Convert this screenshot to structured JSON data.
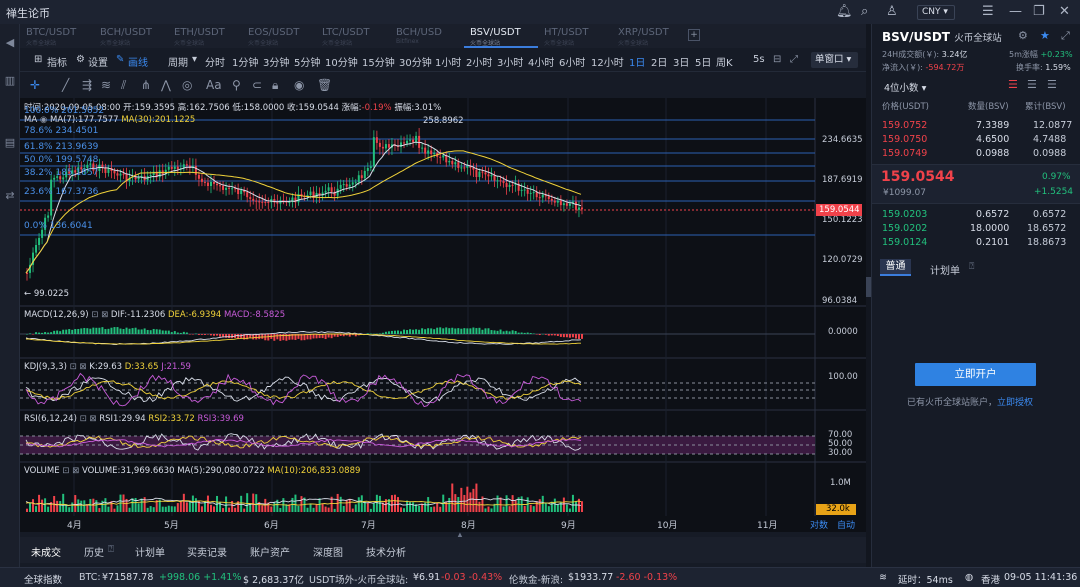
{
  "app": {
    "title": "禅生论币",
    "currency": "CNY"
  },
  "tabs": [
    {
      "name": "BTC/USDT",
      "sub": "火币全球站"
    },
    {
      "name": "BCH/USDT",
      "sub": "火币全球站"
    },
    {
      "name": "ETH/USDT",
      "sub": "火币全球站"
    },
    {
      "name": "EOS/USDT",
      "sub": "火币全球站"
    },
    {
      "name": "LTC/USDT",
      "sub": "火币全球站"
    },
    {
      "name": "BCH/USD",
      "sub": "Bitfinex"
    },
    {
      "name": "BSV/USDT",
      "sub": "火币全球站"
    },
    {
      "name": "HT/USDT",
      "sub": "火币全球站"
    },
    {
      "name": "XRP/USDT",
      "sub": "火币全球站"
    }
  ],
  "toolbar": {
    "indicator": "指标",
    "settings": "设置",
    "draw": "画线",
    "period": "周期",
    "intervals": [
      "分时",
      "1分钟",
      "3分钟",
      "5分钟",
      "10分钟",
      "15分钟",
      "30分钟",
      "1小时",
      "2小时",
      "3小时",
      "4小时",
      "6小时",
      "12小时",
      "1日",
      "2日",
      "3日",
      "5日",
      "周K"
    ],
    "selected_interval": "1日",
    "refresh": "5s",
    "layout": "单窗口"
  },
  "info": {
    "line": "时间:2020-09-05 08:00  开:159.3595  高:162.7506  低:158.0000  收:159.0544  涨幅:",
    "change": "-0.19%",
    "amp_label": "振幅:",
    "amp": "3.01%",
    "ma_line": "MA",
    "ma7": "MA(7):177.7577",
    "ma30": "MA(30):201.1225"
  },
  "fib": [
    "100.0% 261.5052",
    "78.6% 234.4501",
    "61.8% 213.9639",
    "50.0% 199.5748",
    "38.2% 185.1857",
    "23.6% 167.3736",
    "0.0% 136.6041"
  ],
  "price_axis": [
    "234.6635",
    "187.6919",
    "150.1223",
    "120.0729",
    "96.0384"
  ],
  "current_price": "159.0544",
  "high_label": "258.8962",
  "low_label": "← 99.0225",
  "macd": {
    "name": "MACD(12,26,9)",
    "dif": "DIF:-11.2306",
    "dea": "DEA:-6.9394",
    "macd": "MACD:-8.5825",
    "axis": "0.0000"
  },
  "kdj": {
    "name": "KDJ(9,3,3)",
    "k": "K:29.63",
    "d": "D:33.65",
    "j": "J:21.59",
    "axis": "100.00"
  },
  "rsi": {
    "name": "RSI(6,12,24)",
    "r1": "RSI1:29.94",
    "r2": "RSI2:33.72",
    "r3": "RSI3:39.69",
    "axis": [
      "70.00",
      "50.00",
      "30.00"
    ]
  },
  "volume": {
    "name": "VOLUME",
    "vol": "VOLUME:31,969.6630",
    "ma5": "MA(5):290,080.0722",
    "ma10": "MA(10):206,833.0889",
    "axis": "1.0M",
    "current": "32.0k"
  },
  "xaxis": [
    "4月",
    "5月",
    "6月",
    "7月",
    "8月",
    "9月",
    "10月",
    "11月"
  ],
  "xaxis_buttons": {
    "log": "对数",
    "auto": "自动"
  },
  "bottom_tabs": [
    "未成交",
    "历史",
    "计划单",
    "买卖记录",
    "账户资产",
    "深度图",
    "技术分析"
  ],
  "status": {
    "global": "全球指数",
    "btc_label": "BTC:",
    "btc_price": "¥71587.78",
    "btc_change": "+998.06 +1.41%",
    "btc_usd": "$ 2,683.37亿",
    "usdt_label": "USDT场外-火币全球站:",
    "usdt_price": "¥6.91",
    "usdt_change": "-0.03 -0.43%",
    "gold_label": "伦敦金-新浪:",
    "gold_price": "$1933.77",
    "gold_change": "-2.60 -0.13%",
    "latency": "延时：54ms",
    "region": "香港",
    "time": "09-05 11:41:36"
  },
  "right": {
    "pair": "BSV/USDT",
    "exchange": "火币全球站",
    "vol24_label": "24H成交额(￥):",
    "vol24": "3.24亿",
    "rise5_label": "5m涨幅",
    "rise5": "+0.23%",
    "inflow_label": "净流入(￥):",
    "inflow": "-594.72万",
    "turnover_label": "换手率:",
    "turnover": "1.59%",
    "decimal": "4位小数",
    "cols": [
      "价格(USDT)",
      "数量(BSV)",
      "累计(BSV)"
    ],
    "asks": [
      [
        "159.0752",
        "7.3389",
        "12.0877"
      ],
      [
        "159.0750",
        "4.6500",
        "4.7488"
      ],
      [
        "159.0749",
        "0.0988",
        "0.0988"
      ]
    ],
    "last_price": "159.0544",
    "last_cny": "¥1099.07",
    "last_pct": "0.97%",
    "last_chg": "+1.5254",
    "bids": [
      [
        "159.0203",
        "0.6572",
        "0.6572"
      ],
      [
        "159.0202",
        "18.0000",
        "18.6572"
      ],
      [
        "159.0124",
        "0.2101",
        "18.8673"
      ]
    ],
    "order_tabs": [
      "普通",
      "计划单"
    ],
    "open_btn": "立即开户",
    "auth_text": "已有火币全球站账户，",
    "auth_link": "立即授权"
  }
}
